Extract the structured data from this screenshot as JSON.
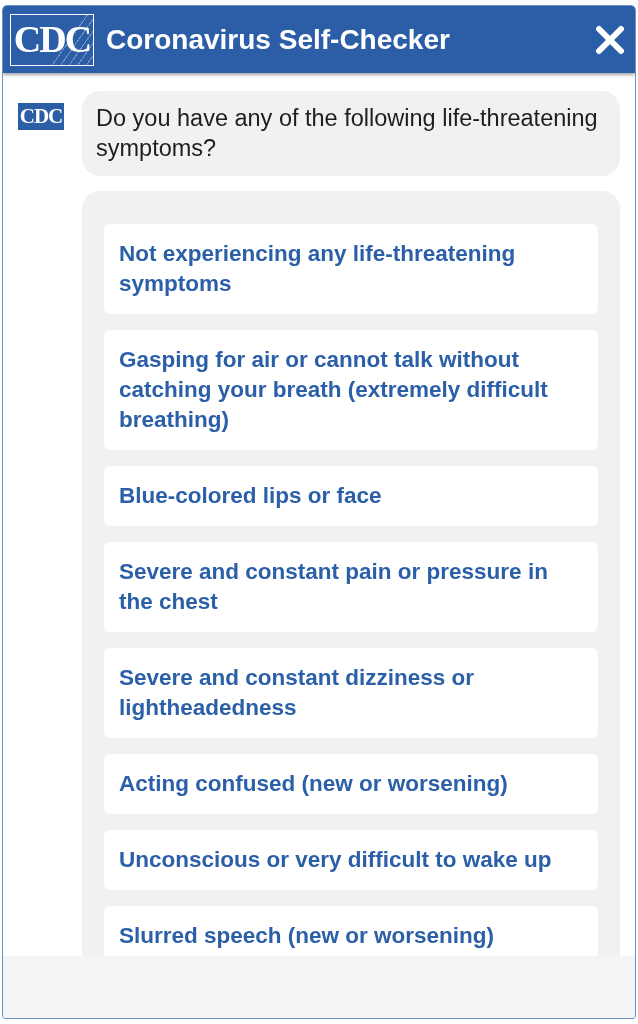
{
  "window": {
    "logo": "CDC",
    "title": "Coronavirus Self-Checker"
  },
  "chat": {
    "avatar": "CDC",
    "question": "Do you have any of the following life-threatening symptoms?",
    "options": [
      {
        "label": "Not experiencing any life-threatening symptoms",
        "selected": false
      },
      {
        "label": "Gasping for air or cannot talk without catching your breath (extremely difficult breathing)",
        "selected": false
      },
      {
        "label": "Blue-colored lips or face",
        "selected": false
      },
      {
        "label": "Severe and constant pain or pressure in the chest",
        "selected": false
      },
      {
        "label": "Severe and constant dizziness or lightheadedness",
        "selected": false
      },
      {
        "label": "Acting confused (new or worsening)",
        "selected": false
      },
      {
        "label": "Unconscious or very difficult to wake up",
        "selected": false
      },
      {
        "label": "Slurred speech (new or worsening)",
        "selected": false
      }
    ]
  }
}
